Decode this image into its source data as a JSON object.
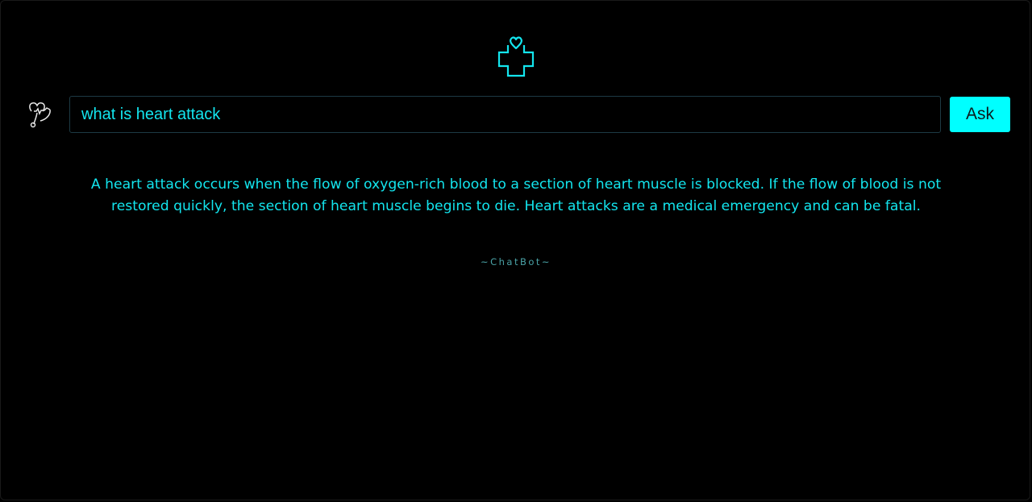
{
  "header": {
    "logo_icon": "medical-cross-heart-icon"
  },
  "query": {
    "icon": "stethoscope-icon",
    "value": "what is heart attack",
    "ask_label": "Ask"
  },
  "response": {
    "text": "A heart attack occurs when the flow of oxygen-rich blood to a section of heart muscle is blocked. If the flow of blood is not restored quickly, the section of heart muscle begins to die. Heart attacks are a medical emergency and can be fatal."
  },
  "footer": {
    "text": "~ChatBot~"
  },
  "colors": {
    "accent": "#00ffff",
    "text": "#13e5ee",
    "background": "#000000"
  }
}
